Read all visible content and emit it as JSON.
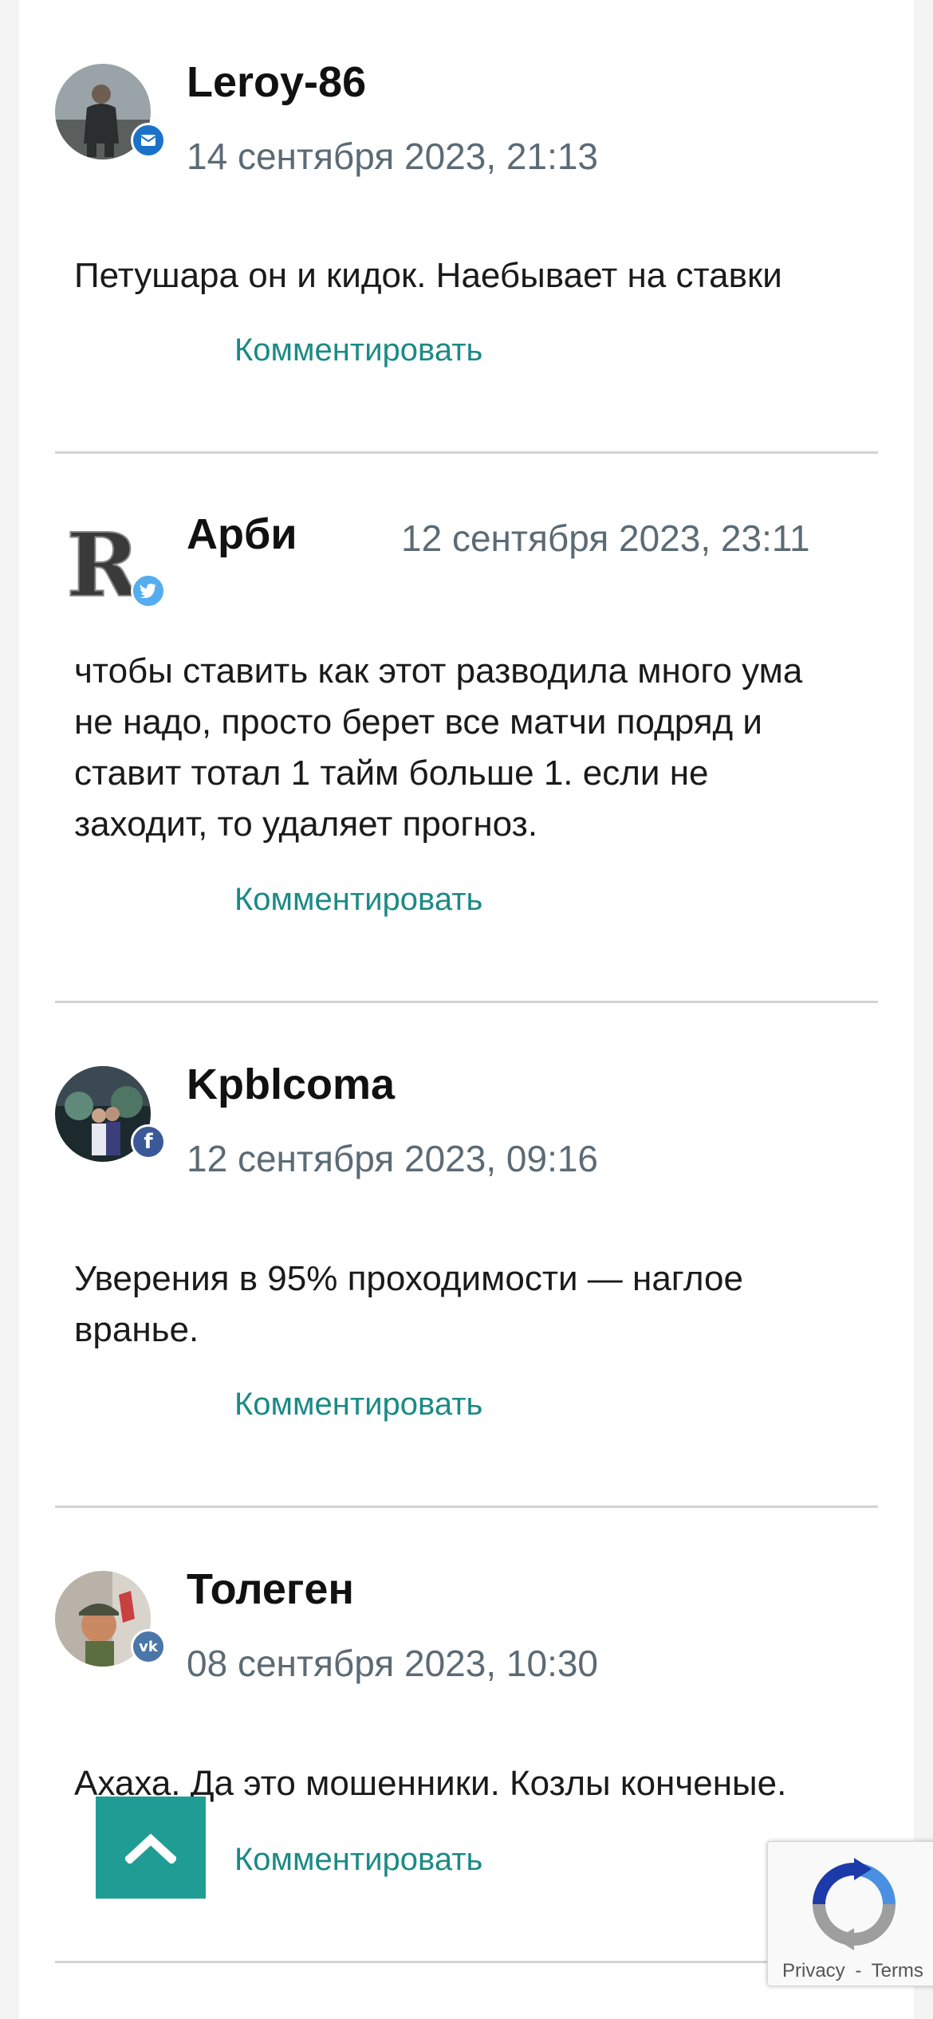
{
  "comments": [
    {
      "author": "Leroy-86",
      "date": "14 сентября 2023, 21:13",
      "text": "Петушара он и кидок. Наебывает на ставки",
      "reply_label": "Комментировать",
      "badge": "mail-icon",
      "badge_color": "#1a73c9"
    },
    {
      "author": "Арби",
      "date": "12 сентября 2023, 23:11",
      "text": "чтобы ставить как этот разводила много ума не надо, просто берет все матчи подряд и ставит тотал 1 тайм больше 1. если не заходит, то удаляет прогноз.",
      "reply_label": "Комментировать",
      "badge": "twitter-icon",
      "badge_color": "#55acee"
    },
    {
      "author": "Kpblcoma",
      "date": "12 сентября 2023, 09:16",
      "text": "Уверения в 95% проходимости — наглое вранье.",
      "reply_label": "Комментировать",
      "badge": "facebook-icon",
      "badge_color": "#3b5998"
    },
    {
      "author": "Толеген",
      "date": "08 сентября 2023, 10:30",
      "text": "Ахаха. Да это мошенники. Козлы конченые.",
      "reply_label": "Комментировать",
      "badge": "vk-icon",
      "badge_color": "#4a76a8"
    }
  ],
  "recaptcha": {
    "privacy": "Privacy",
    "separator": "-",
    "terms": "Terms"
  },
  "colors": {
    "accent": "#1f9d95",
    "link": "#1b8a86",
    "date": "#5b6b75"
  }
}
